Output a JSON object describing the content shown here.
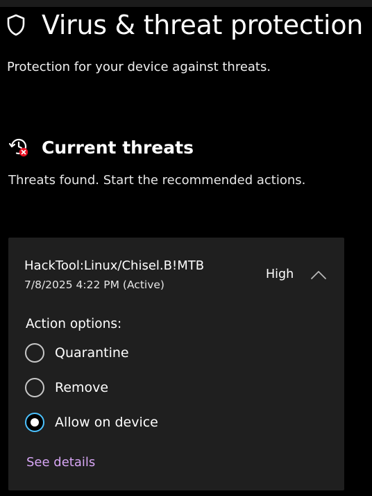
{
  "header": {
    "title": "Virus & threat protection",
    "subtitle": "Protection for your device against threats.",
    "icon": "shield-icon"
  },
  "current_threats": {
    "title": "Current threats",
    "icon": "history-alert-icon",
    "description": "Threats found. Start the recommended actions."
  },
  "threat": {
    "name": "HackTool:Linux/Chisel.B!MTB",
    "date": "7/8/2025 4:22 PM (Active)",
    "severity": "High",
    "expanded": true,
    "action_label": "Action options:",
    "options": [
      {
        "label": "Quarantine",
        "selected": false
      },
      {
        "label": "Remove",
        "selected": false
      },
      {
        "label": "Allow on device",
        "selected": true
      }
    ],
    "details_link": "See details"
  },
  "colors": {
    "background": "#000000",
    "card": "#1f1f1f",
    "accent": "#4cc2ff",
    "link": "#d7a6f5"
  }
}
